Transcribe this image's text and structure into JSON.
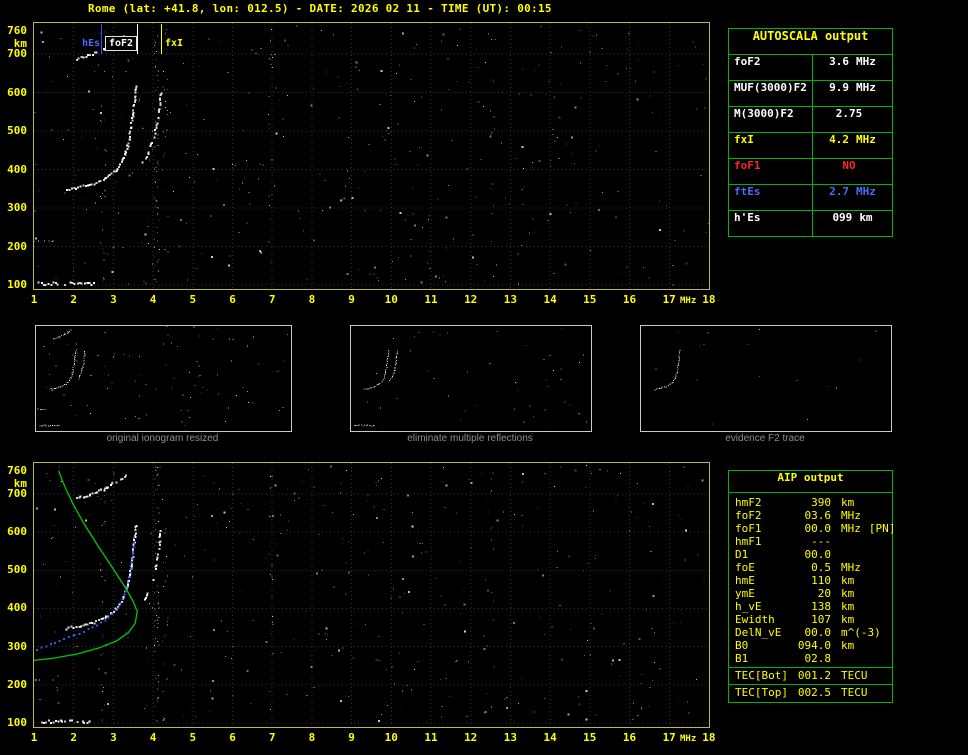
{
  "title": "Rome (lat: +41.8, lon: 012.5) - DATE: 2026 02 11 - TIME (UT): 00:15",
  "colors": {
    "accent_yellow": "#ffff00",
    "plot_border": "#b9b94e",
    "grid": "#343434",
    "table_green": "#00b400",
    "trace_white": "#ffffff",
    "profile_green": "#00c800",
    "scaled_blue": "#3a5cff",
    "marker_blue": "#2a50ff",
    "fof1_red": "#ff2222",
    "ftes_blue": "#4a6aff",
    "caption_gray": "#8f8f8f"
  },
  "axes": {
    "x_ticks": [
      "1",
      "2",
      "3",
      "4",
      "5",
      "6",
      "7",
      "8",
      "9",
      "10",
      "11",
      "12",
      "13",
      "14",
      "15",
      "16",
      "17",
      "18"
    ],
    "x_unit": "MHz",
    "y_ticks": [
      "760",
      "700",
      "600",
      "500",
      "400",
      "300",
      "200",
      "100"
    ],
    "y_unit": "km",
    "x_range_mhz": [
      1,
      18
    ],
    "y_range_km": [
      100,
      760
    ]
  },
  "top_plot": {
    "markers": [
      {
        "label": "hEs",
        "freq_mhz": 2.7,
        "color": "#4a6aff"
      },
      {
        "label": "foF2",
        "freq_mhz": 3.6,
        "color": "#ffffff"
      },
      {
        "label": "fxI",
        "freq_mhz": 4.2,
        "color": "#ffff00"
      }
    ]
  },
  "autoscala": {
    "header": "AUTOSCALA output",
    "rows": [
      {
        "param": "foF2",
        "value": "3.6",
        "unit": "MHz",
        "color": "#ffffff"
      },
      {
        "param": "MUF(3000)F2",
        "value": "9.9",
        "unit": "MHz",
        "color": "#ffffff"
      },
      {
        "param": "M(3000)F2",
        "value": "2.75",
        "unit": "",
        "color": "#ffffff"
      },
      {
        "param": "fxI",
        "value": "4.2",
        "unit": "MHz",
        "color": "#ffff00"
      },
      {
        "param": "foF1",
        "value": "NO",
        "unit": "",
        "color": "#ff2222"
      },
      {
        "param": "ftEs",
        "value": "2.7",
        "unit": "MHz",
        "color": "#4a6aff"
      },
      {
        "param": "h'Es",
        "value": "099",
        "unit": "km",
        "color": "#ffffff"
      }
    ]
  },
  "thumbnails": [
    {
      "caption": "original ionogram resized"
    },
    {
      "caption": "eliminate multiple reflections"
    },
    {
      "caption": "evidence F2 trace"
    }
  ],
  "aip": {
    "header": "AIP output",
    "rows": [
      {
        "param": "hmF2",
        "value": "390",
        "unit": "km",
        "extra": ""
      },
      {
        "param": "foF2",
        "value": "03.6",
        "unit": "MHz",
        "extra": ""
      },
      {
        "param": "foF1",
        "value": "00.0",
        "unit": "MHz",
        "extra": "[PN]"
      },
      {
        "param": "hmF1",
        "value": "---",
        "unit": "",
        "extra": ""
      },
      {
        "param": "D1",
        "value": "00.0",
        "unit": "",
        "extra": ""
      },
      {
        "param": "foE",
        "value": "0.5",
        "unit": "MHz",
        "extra": ""
      },
      {
        "param": "hmE",
        "value": "110",
        "unit": "km",
        "extra": ""
      },
      {
        "param": "ymE",
        "value": "20",
        "unit": "km",
        "extra": ""
      },
      {
        "param": "h_vE",
        "value": "138",
        "unit": "km",
        "extra": ""
      },
      {
        "param": "Ewidth",
        "value": "107",
        "unit": "km",
        "extra": ""
      },
      {
        "param": "DelN_vE",
        "value": "00.0",
        "unit": "m^(-3)",
        "extra": ""
      },
      {
        "param": "B0",
        "value": "094.0",
        "unit": "km",
        "extra": ""
      },
      {
        "param": "B1",
        "value": "02.8",
        "unit": "",
        "extra": ""
      },
      {
        "param": "TEC[Bot]",
        "value": "001.2",
        "unit": "TECU",
        "extra": ""
      },
      {
        "param": "TEC[Top]",
        "value": "002.5",
        "unit": "TECU",
        "extra": ""
      }
    ]
  },
  "ionogram": {
    "traces": {
      "es_layer": [
        [
          1.1,
          106
        ],
        [
          2.5,
          106
        ]
      ],
      "es_second": [
        [
          1.0,
          215
        ],
        [
          1.5,
          215
        ]
      ],
      "f_ordinary": [
        [
          1.8,
          350
        ],
        [
          2.15,
          357
        ],
        [
          2.5,
          366
        ],
        [
          2.8,
          380
        ],
        [
          3.05,
          400
        ],
        [
          3.22,
          428
        ],
        [
          3.34,
          465
        ],
        [
          3.43,
          515
        ],
        [
          3.5,
          570
        ],
        [
          3.56,
          620
        ]
      ],
      "f_extraordinary": [
        [
          3.72,
          420
        ],
        [
          3.86,
          445
        ],
        [
          3.98,
          480
        ],
        [
          4.08,
          525
        ],
        [
          4.15,
          575
        ],
        [
          4.18,
          618
        ]
      ],
      "f_second_hop": [
        [
          2.05,
          690
        ],
        [
          2.4,
          700
        ],
        [
          2.75,
          715
        ],
        [
          3.05,
          733
        ],
        [
          3.3,
          752
        ]
      ]
    },
    "scaled_trace": [
      [
        1.05,
        295
      ],
      [
        1.5,
        312
      ],
      [
        2.0,
        332
      ],
      [
        2.45,
        352
      ],
      [
        2.85,
        378
      ],
      [
        3.1,
        405
      ],
      [
        3.28,
        445
      ],
      [
        3.4,
        495
      ],
      [
        3.47,
        550
      ],
      [
        3.5,
        595
      ]
    ],
    "profile": [
      [
        1.62,
        760
      ],
      [
        1.78,
        718
      ],
      [
        2.0,
        670
      ],
      [
        2.3,
        615
      ],
      [
        2.65,
        558
      ],
      [
        3.0,
        503
      ],
      [
        3.3,
        455
      ],
      [
        3.5,
        418
      ],
      [
        3.6,
        392
      ],
      [
        3.55,
        362
      ],
      [
        3.38,
        337
      ],
      [
        3.08,
        315
      ],
      [
        2.65,
        297
      ],
      [
        2.1,
        281
      ],
      [
        1.5,
        270
      ],
      [
        1.0,
        264
      ]
    ],
    "noise": {
      "base": 380,
      "strips": [
        [
          2.72,
          22
        ],
        [
          4.08,
          55
        ],
        [
          4.3,
          18
        ],
        [
          6.95,
          16
        ],
        [
          12.55,
          10
        ]
      ]
    }
  }
}
